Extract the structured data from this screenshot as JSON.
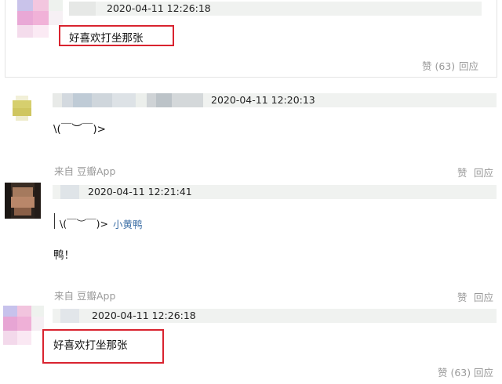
{
  "comments": [
    {
      "timestamp": "2020-04-11 12:26:18",
      "text": "好喜欢打坐那张",
      "likes": "赞 (63)",
      "reply": "回应"
    },
    {
      "timestamp": "2020-04-11 12:20:13",
      "text": "\\(￣︶￣)>",
      "source": "来自 豆瓣App",
      "like": "赞",
      "reply": "回应"
    },
    {
      "timestamp": "2020-04-11 12:21:41",
      "quote_text": "\\(￣︶￣)>",
      "quote_author": "小黄鸭",
      "text": "鸭！",
      "source": "来自 豆瓣App",
      "like": "赞",
      "reply": "回应"
    },
    {
      "timestamp": "2020-04-11 12:26:18",
      "text": "好喜欢打坐那张",
      "likes": "赞 (63)",
      "reply": "回应"
    }
  ],
  "colors": {
    "highlight_box": "#d9232f",
    "meta_bar": "#f0f2f0",
    "link": "#3b6ea5",
    "muted": "#999999"
  }
}
